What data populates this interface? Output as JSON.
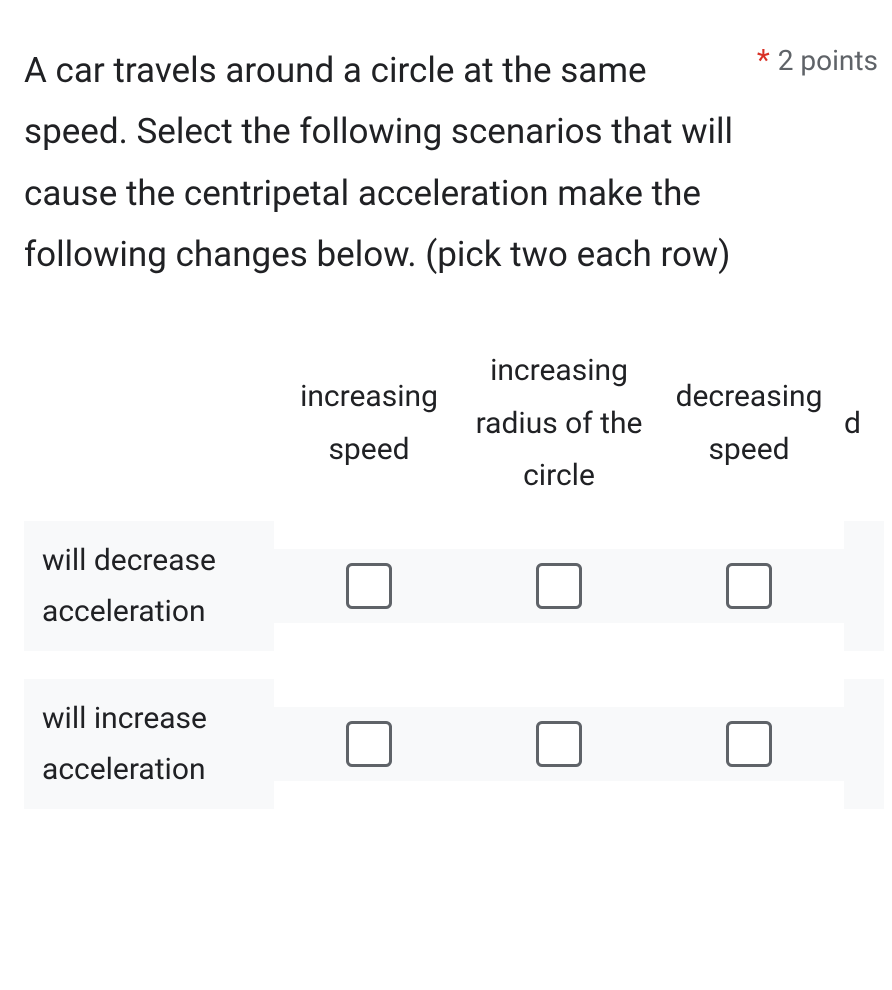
{
  "question": {
    "text": "A car travels around a circle at the same speed. Select the following scenarios that will cause the centripetal acceleration make the following changes below. (pick two each row)",
    "required_marker": "*",
    "points_label": "2 points"
  },
  "grid": {
    "columns": [
      "increasing speed",
      "increasing radius of the circle",
      "decreasing speed"
    ],
    "partial_next_column": "d",
    "rows": [
      {
        "label": "will decrease acceleration"
      },
      {
        "label": "will increase acceleration"
      }
    ]
  }
}
